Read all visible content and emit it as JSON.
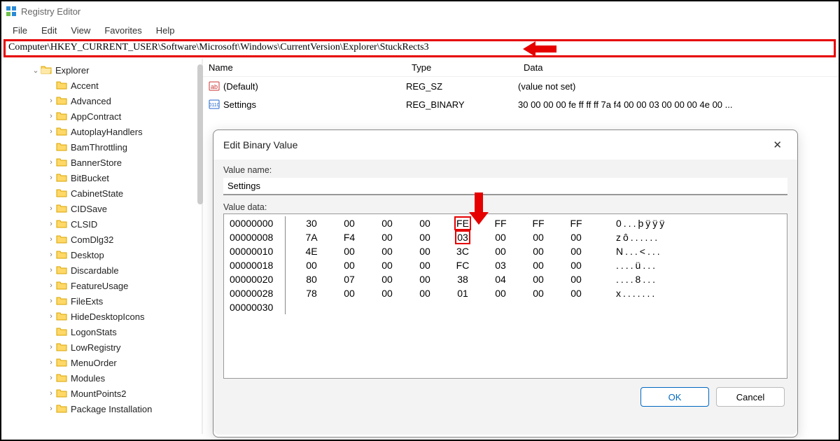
{
  "app": {
    "title": "Registry Editor"
  },
  "menu": {
    "file": "File",
    "edit": "Edit",
    "view": "View",
    "favorites": "Favorites",
    "help": "Help"
  },
  "address": "Computer\\HKEY_CURRENT_USER\\Software\\Microsoft\\Windows\\CurrentVersion\\Explorer\\StuckRects3",
  "tree": {
    "parent": "Explorer",
    "items": [
      {
        "label": "Accent",
        "exp": false
      },
      {
        "label": "Advanced",
        "exp": true
      },
      {
        "label": "AppContract",
        "exp": true
      },
      {
        "label": "AutoplayHandlers",
        "exp": true
      },
      {
        "label": "BamThrottling",
        "exp": false
      },
      {
        "label": "BannerStore",
        "exp": true
      },
      {
        "label": "BitBucket",
        "exp": true
      },
      {
        "label": "CabinetState",
        "exp": false
      },
      {
        "label": "CIDSave",
        "exp": true
      },
      {
        "label": "CLSID",
        "exp": true
      },
      {
        "label": "ComDlg32",
        "exp": true
      },
      {
        "label": "Desktop",
        "exp": true
      },
      {
        "label": "Discardable",
        "exp": true
      },
      {
        "label": "FeatureUsage",
        "exp": true
      },
      {
        "label": "FileExts",
        "exp": true
      },
      {
        "label": "HideDesktopIcons",
        "exp": true
      },
      {
        "label": "LogonStats",
        "exp": false
      },
      {
        "label": "LowRegistry",
        "exp": true
      },
      {
        "label": "MenuOrder",
        "exp": true
      },
      {
        "label": "Modules",
        "exp": true
      },
      {
        "label": "MountPoints2",
        "exp": true
      },
      {
        "label": "Package Installation",
        "exp": true
      }
    ]
  },
  "list": {
    "headers": {
      "name": "Name",
      "type": "Type",
      "data": "Data"
    },
    "rows": [
      {
        "name": "(Default)",
        "type": "REG_SZ",
        "data": "(value not set)",
        "icon": "str"
      },
      {
        "name": "Settings",
        "type": "REG_BINARY",
        "data": "30 00 00 00 fe ff ff ff 7a f4 00 00 03 00 00 00 4e 00 ...",
        "icon": "bin"
      }
    ]
  },
  "dialog": {
    "title": "Edit Binary Value",
    "label_name": "Value name:",
    "value_name": "Settings",
    "label_data": "Value data:",
    "hex": [
      {
        "off": "00000000",
        "b": [
          "30",
          "00",
          "00",
          "00",
          "FE",
          "FF",
          "FF",
          "FF"
        ],
        "a": "0...þÿÿÿ",
        "hl": 4
      },
      {
        "off": "00000008",
        "b": [
          "7A",
          "F4",
          "00",
          "00",
          "03",
          "00",
          "00",
          "00"
        ],
        "a": "zô......",
        "hl": 4
      },
      {
        "off": "00000010",
        "b": [
          "4E",
          "00",
          "00",
          "00",
          "3C",
          "00",
          "00",
          "00"
        ],
        "a": "N...<..."
      },
      {
        "off": "00000018",
        "b": [
          "00",
          "00",
          "00",
          "00",
          "FC",
          "03",
          "00",
          "00"
        ],
        "a": "....ü..."
      },
      {
        "off": "00000020",
        "b": [
          "80",
          "07",
          "00",
          "00",
          "38",
          "04",
          "00",
          "00"
        ],
        "a": "....8..."
      },
      {
        "off": "00000028",
        "b": [
          "78",
          "00",
          "00",
          "00",
          "01",
          "00",
          "00",
          "00"
        ],
        "a": "x......."
      },
      {
        "off": "00000030",
        "b": [],
        "a": ""
      }
    ],
    "ok": "OK",
    "cancel": "Cancel"
  }
}
